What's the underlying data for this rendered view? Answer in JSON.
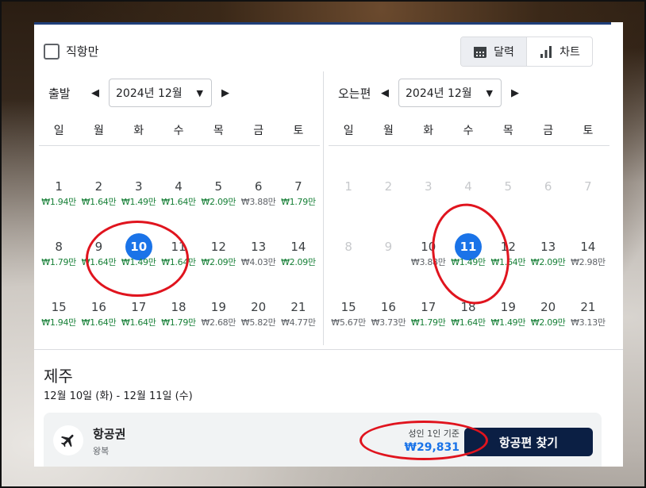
{
  "filters": {
    "direct_only_label": "직항만"
  },
  "view_toggle": {
    "calendar_label": "달력",
    "chart_label": "차트"
  },
  "weekdays": [
    "일",
    "월",
    "화",
    "수",
    "목",
    "금",
    "토"
  ],
  "departure": {
    "label": "출발",
    "month_value": "2024년 12월",
    "weeks": [
      [
        {
          "d": "1",
          "p": "₩1.94만",
          "c": "g"
        },
        {
          "d": "2",
          "p": "₩1.64만",
          "c": "g"
        },
        {
          "d": "3",
          "p": "₩1.49만",
          "c": "g"
        },
        {
          "d": "4",
          "p": "₩1.64만",
          "c": "g"
        },
        {
          "d": "5",
          "p": "₩2.09만",
          "c": "g"
        },
        {
          "d": "6",
          "p": "₩3.88만",
          "c": "k"
        },
        {
          "d": "7",
          "p": "₩1.79만",
          "c": "g"
        }
      ],
      [
        {
          "d": "8",
          "p": "₩1.79만",
          "c": "g"
        },
        {
          "d": "9",
          "p": "₩1.64만",
          "c": "g"
        },
        {
          "d": "10",
          "p": "₩1.49만",
          "c": "g",
          "sel": true
        },
        {
          "d": "11",
          "p": "₩1.64만",
          "c": "g"
        },
        {
          "d": "12",
          "p": "₩2.09만",
          "c": "g"
        },
        {
          "d": "13",
          "p": "₩4.03만",
          "c": "k"
        },
        {
          "d": "14",
          "p": "₩2.09만",
          "c": "g"
        }
      ],
      [
        {
          "d": "15",
          "p": "₩1.94만",
          "c": "g"
        },
        {
          "d": "16",
          "p": "₩1.64만",
          "c": "g"
        },
        {
          "d": "17",
          "p": "₩1.64만",
          "c": "g"
        },
        {
          "d": "18",
          "p": "₩1.79만",
          "c": "g"
        },
        {
          "d": "19",
          "p": "₩2.68만",
          "c": "k"
        },
        {
          "d": "20",
          "p": "₩5.82만",
          "c": "k"
        },
        {
          "d": "21",
          "p": "₩4.77만",
          "c": "k"
        }
      ]
    ]
  },
  "return": {
    "label": "오는편",
    "month_value": "2024년 12월",
    "weeks": [
      [
        {
          "d": "1",
          "dis": true
        },
        {
          "d": "2",
          "dis": true
        },
        {
          "d": "3",
          "dis": true
        },
        {
          "d": "4",
          "dis": true
        },
        {
          "d": "5",
          "dis": true
        },
        {
          "d": "6",
          "dis": true
        },
        {
          "d": "7",
          "dis": true
        }
      ],
      [
        {
          "d": "8",
          "dis": true
        },
        {
          "d": "9",
          "dis": true
        },
        {
          "d": "10",
          "p": "₩3.88만",
          "c": "k"
        },
        {
          "d": "11",
          "p": "₩1.49만",
          "c": "g",
          "sel": true
        },
        {
          "d": "12",
          "p": "₩1.64만",
          "c": "g"
        },
        {
          "d": "13",
          "p": "₩2.09만",
          "c": "g"
        },
        {
          "d": "14",
          "p": "₩2.98만",
          "c": "k"
        }
      ],
      [
        {
          "d": "15",
          "p": "₩5.67만",
          "c": "k"
        },
        {
          "d": "16",
          "p": "₩3.73만",
          "c": "k"
        },
        {
          "d": "17",
          "p": "₩1.79만",
          "c": "g"
        },
        {
          "d": "18",
          "p": "₩1.64만",
          "c": "g"
        },
        {
          "d": "19",
          "p": "₩1.49만",
          "c": "g"
        },
        {
          "d": "20",
          "p": "₩2.09만",
          "c": "g"
        },
        {
          "d": "21",
          "p": "₩3.13만",
          "c": "k"
        }
      ]
    ]
  },
  "summary": {
    "destination": "제주",
    "date_range": "12월 10일 (화) - 12월 11일 (수)",
    "ticket_title": "항공권",
    "ticket_type": "왕복",
    "price_basis": "성인 1인 기준",
    "price": "₩29,831",
    "find_button": "항공편 찾기"
  },
  "colors": {
    "selected": "#1a73e8",
    "cheap": "#188038",
    "button": "#0b1f44",
    "annotation": "#e0141e"
  }
}
